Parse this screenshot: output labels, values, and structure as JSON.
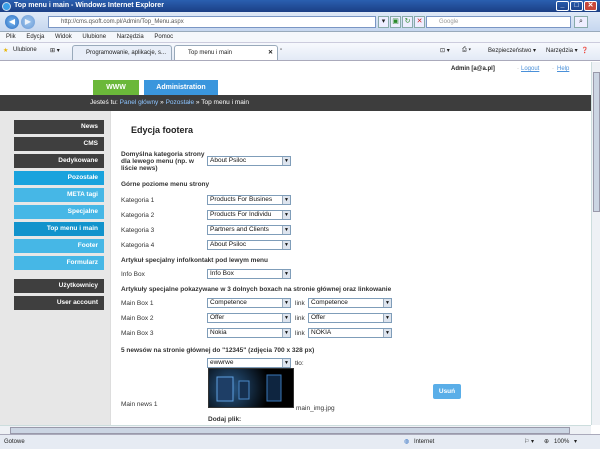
{
  "window": {
    "title": "Top menu i main - Windows Internet Explorer",
    "url": "http://cms.qsoft.com.pl/Admin/Top_Menu.aspx",
    "search_placeholder": "Google"
  },
  "menubar": [
    "Plik",
    "Edycja",
    "Widok",
    "Ulubione",
    "Narzędzia",
    "Pomoc"
  ],
  "favbar": {
    "favorites_label": "Ulubione",
    "tab1": "Programowanie, aplikacje, s...",
    "tab2": "Top menu i main",
    "security": "Bezpieczeństwo",
    "tools": "Narzędzia"
  },
  "userbar": {
    "user": "Admin [a@a.pl]",
    "logout": "Logout",
    "help": "Help"
  },
  "toptabs": {
    "www": "WWW",
    "admin": "Administration"
  },
  "breadcrumb": {
    "prefix": "Jesteś tu:",
    "link1": "Panel główny",
    "sep": "»",
    "link2": "Pozostałe",
    "current": "Top menu i main"
  },
  "sidebar": {
    "news": "News",
    "cms": "CMS",
    "dedykowane": "Dedykowane",
    "pozostale": "Pozostałe",
    "meta": "META tagi",
    "specjalne": "Specjalne",
    "topmenu": "Top menu i main",
    "footer": "Footer",
    "formularz": "Formularz",
    "uzytkownicy": "Użytkownicy",
    "useraccount": "User account"
  },
  "content": {
    "title": "Edycja footera",
    "default_cat_label": "Domyślna kategoria strony dla lewego menu (np. w liście news)",
    "default_cat_value": "About Psiloc",
    "top_menu_heading": "Górne poziome menu strony",
    "cat1_label": "Kategoria 1",
    "cat1_value": "Products For Busines",
    "cat2_label": "Kategoria 2",
    "cat2_value": "Products For Individu",
    "cat3_label": "Kategoria 3",
    "cat3_value": "Partners and Clients",
    "cat4_label": "Kategoria 4",
    "cat4_value": "About Psiloc",
    "special_heading": "Artykuł specjalny info/kontakt pod lewym menu",
    "infobox_label": "Info Box",
    "infobox_value": "Info Box",
    "boxes_heading": "Artykuły specjalne pokazywane w 3 dolnych boxach na stronie głównej oraz linkowanie",
    "mainbox1_label": "Main Box 1",
    "mainbox1_value": "Competence",
    "mainbox1_link": "Competence",
    "mainbox2_label": "Main Box 2",
    "mainbox2_value": "Offer",
    "mainbox2_link": "Offer",
    "mainbox3_label": "Main Box 3",
    "mainbox3_value": "Nokia",
    "mainbox3_link": "NOKIA",
    "link_label": "link",
    "news_heading": "5 newsów na stronie głównej do \"12345\" (zdjęcia 700 x 328 px)",
    "news1_select": "ewwrwe",
    "tlo_label": "tło:",
    "mainnews1_label": "Main news 1",
    "img_name": "main_img.jpg",
    "delete_button": "Usuń",
    "add_file_label": "Dodaj plik:"
  },
  "statusbar": {
    "status": "Gotowe",
    "zone": "Internet",
    "zoom": "100%"
  }
}
